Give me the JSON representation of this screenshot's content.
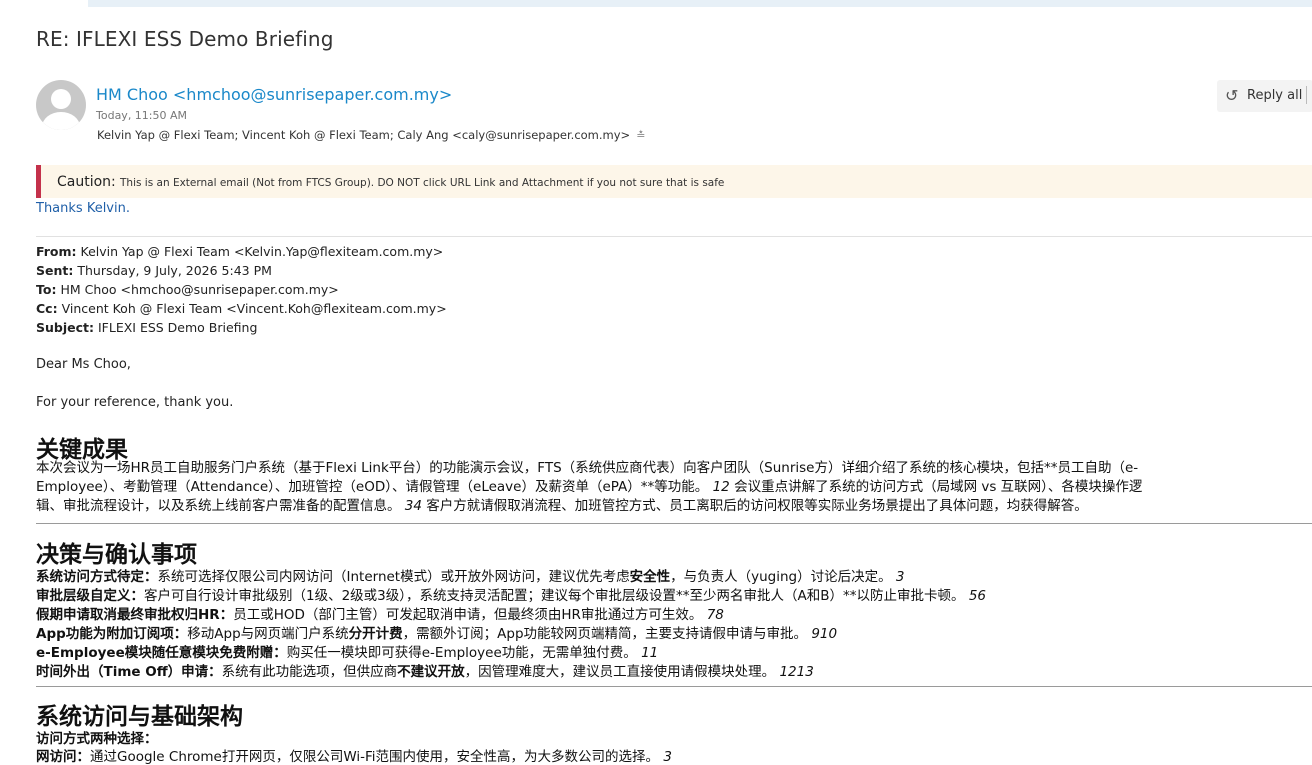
{
  "email": {
    "subject": "RE: IFLEXI ESS Demo Briefing",
    "sender": "HM Choo <hmchoo@sunrisepaper.com.my>",
    "time": "Today, 11:50 AM",
    "recipients": "Kelvin Yap @ Flexi Team; Vincent Koh @ Flexi Team; Caly Ang <caly@sunrisepaper.com.my>",
    "reply_all": "Reply all",
    "caution_title": "Caution:",
    "caution_text": "This is an External email (Not from FTCS Group). DO NOT click URL Link and Attachment if you not sure that is safe",
    "reply_body": "Thanks Kelvin."
  },
  "quoted": {
    "from_label": "From:",
    "from": "Kelvin Yap @ Flexi Team <Kelvin.Yap@flexiteam.com.my>",
    "sent_label": "Sent:",
    "sent": "Thursday, 9 July, 2026 5:43 PM",
    "to_label": "To:",
    "to": "HM Choo <hmchoo@sunrisepaper.com.my>",
    "cc_label": "Cc:",
    "cc": "Vincent Koh @ Flexi Team <Vincent.Koh@flexiteam.com.my>",
    "subject_label": "Subject:",
    "subject": "IFLEXI ESS Demo Briefing",
    "greeting": "Dear Ms Choo,",
    "intro": "For your reference, thank you."
  },
  "summary": {
    "heading": "关键成果",
    "lines": [
      "本次会议为一场HR员工自助服务门户系统（基于Flexi Link平台）的功能演示会议，FTS（系统供应商代表）向客户团队（Sunrise方）详细介绍了系统的核心模块，包括**员工自助（e-",
      "Employee）、考勤管理（Attendance）、加班管控（eOD）、请假管理（eLeave）及薪资单（ePA）**等功能。",
      "12",
      " 会议重点讲解了系统的访问方式（局域网 vs 互联网）、各模块操作逻",
      "辑、审批流程设计，以及系统上线前客户需准备的配置信息。",
      "34",
      " 客户方就请假取消流程、加班管控方式、员工离职后的访问权限等实际业务场景提出了具体问题，均获得解答。"
    ]
  },
  "decisions": {
    "heading": "决策与确认事项",
    "items": [
      {
        "label": "系统访问方式待定：",
        "text": "系统可选择仅限公司内网访问（Internet模式）或开放外网访问，建议优先考虑",
        "bold2": "安全性",
        "text2": "，与负责人（yuging）讨论后决定。",
        "ref": "3"
      },
      {
        "label": "审批层级自定义：",
        "text": "客户可自行设计审批级别（1级、2级或3级），系统支持灵活配置；建议每个审批层级设置**至少两名审批人（A和B）**以防止审批卡顿。",
        "bold2": "",
        "text2": "",
        "ref": "56"
      },
      {
        "label": "假期申请取消最终审批权归HR：",
        "text": "员工或HOD（部门主管）可发起取消申请，但最终须由HR审批通过方可生效。",
        "bold2": "",
        "text2": "",
        "ref": "78"
      },
      {
        "label": "App功能为附加订阅项：",
        "text": "移动App与网页端门户系统",
        "bold2": "分开计费",
        "text2": "，需额外订阅；App功能较网页端精简，主要支持请假申请与审批。",
        "ref": "910"
      },
      {
        "label": "e-Employee模块随任意模块免费附赠：",
        "text": "购买任一模块即可获得e-Employee功能，无需单独付费。",
        "bold2": "",
        "text2": "",
        "ref": "11"
      },
      {
        "label": "时间外出（Time Off）申请：",
        "text": "系统有此功能选项，但供应商",
        "bold2": "不建议开放",
        "text2": "，因管理难度大，建议员工直接使用请假模块处理。",
        "ref": "1213"
      }
    ]
  },
  "access": {
    "heading": "系统访问与基础架构",
    "sub_label": "访问方式两种选择：",
    "line_label": "网访问：",
    "line_text": "通过Google Chrome打开网页，仅限公司Wi-Fi范围内使用，安全性高，为大多数公司的选择。",
    "line_ref": "3"
  }
}
